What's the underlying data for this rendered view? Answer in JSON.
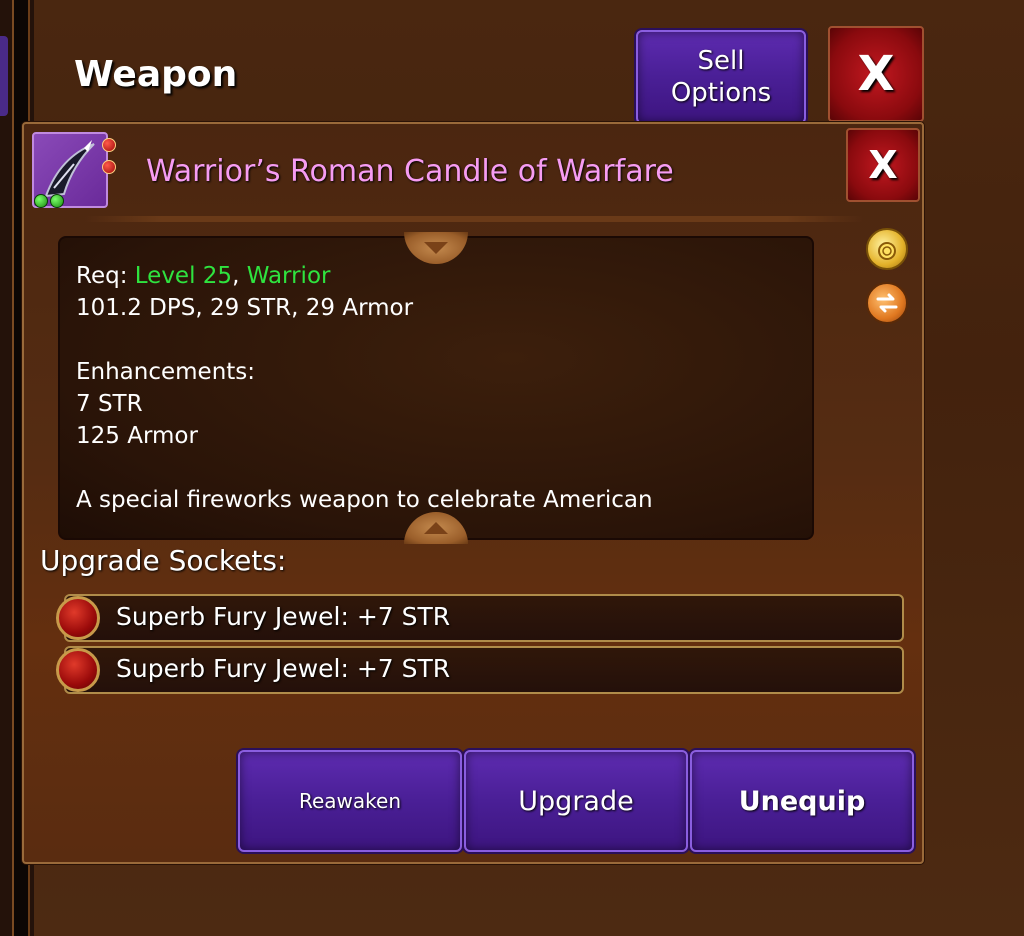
{
  "header": {
    "title": "Weapon",
    "sell_button": "Sell\nOptions",
    "close_label": "X"
  },
  "item": {
    "name": "Warrior’s Roman Candle of Warfare",
    "name_color": "#f69cf2",
    "close_label": "X",
    "description": {
      "req_prefix": "Req: ",
      "req_level": "Level 25",
      "req_sep": ", ",
      "req_class": "Warrior",
      "stats": "101.2 DPS, 29 STR, 29 Armor",
      "enhancements_label": "Enhancements:",
      "enhancement_1": "7 STR",
      "enhancement_2": "125 Armor",
      "flavor": "A special fireworks weapon to celebrate American"
    }
  },
  "sockets": {
    "label": "Upgrade Sockets:",
    "items": [
      {
        "text": "Superb Fury Jewel: +7 STR"
      },
      {
        "text": "Superb Fury Jewel: +7 STR"
      }
    ]
  },
  "actions": {
    "reawaken": "Reawaken",
    "upgrade": "Upgrade",
    "unequip": "Unequip"
  },
  "colors": {
    "requirement_green": "#2fe33f",
    "button_purple": "#4a1f96",
    "close_red": "#8a0a0e"
  },
  "icons": {
    "side_top": "gold-bag-icon",
    "side_bottom": "swap-icon"
  }
}
